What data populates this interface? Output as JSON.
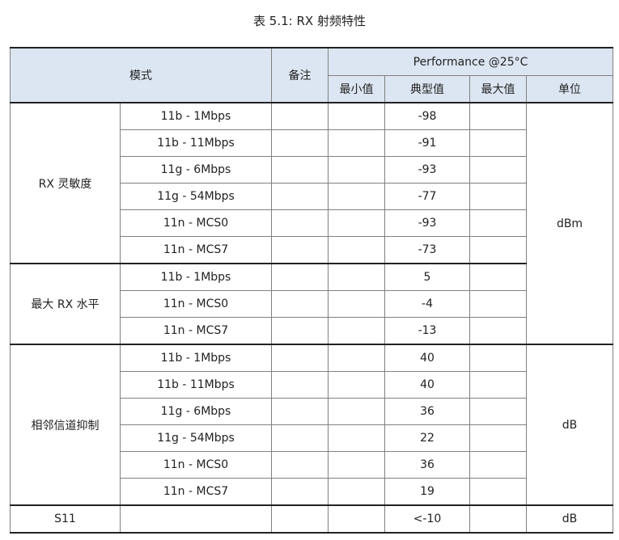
{
  "caption": "表 5.1: RX 射频特性",
  "header": {
    "mode": "模式",
    "remark": "备注",
    "performance": "Performance @25°C",
    "min": "最小值",
    "typ": "典型值",
    "max": "最大值",
    "unit": "单位"
  },
  "groups": [
    {
      "name": "RX 灵敏度",
      "unit": "dBm",
      "rows": [
        {
          "mode": "11b - 1Mbps",
          "typ": "-98"
        },
        {
          "mode": "11b - 11Mbps",
          "typ": "-91"
        },
        {
          "mode": "11g - 6Mbps",
          "typ": "-93"
        },
        {
          "mode": "11g - 54Mbps",
          "typ": "-77"
        },
        {
          "mode": "11n - MCS0",
          "typ": "-93"
        },
        {
          "mode": "11n - MCS7",
          "typ": "-73"
        }
      ]
    },
    {
      "name": "最大 RX 水平",
      "unit": "",
      "rows": [
        {
          "mode": "11b - 1Mbps",
          "typ": "5"
        },
        {
          "mode": "11n - MCS0",
          "typ": "-4"
        },
        {
          "mode": "11n - MCS7",
          "typ": "-13"
        }
      ]
    },
    {
      "name": "相邻信道抑制",
      "unit": "dB",
      "rows": [
        {
          "mode": "11b - 1Mbps",
          "typ": "40"
        },
        {
          "mode": "11b - 11Mbps",
          "typ": "40"
        },
        {
          "mode": "11g - 6Mbps",
          "typ": "36"
        },
        {
          "mode": "11g - 54Mbps",
          "typ": "22"
        },
        {
          "mode": "11n - MCS0",
          "typ": "36"
        },
        {
          "mode": "11n - MCS7",
          "typ": "19"
        }
      ]
    },
    {
      "name": "S11",
      "unit": "dB",
      "rows": [
        {
          "mode": "",
          "typ": "<-10"
        }
      ]
    }
  ]
}
